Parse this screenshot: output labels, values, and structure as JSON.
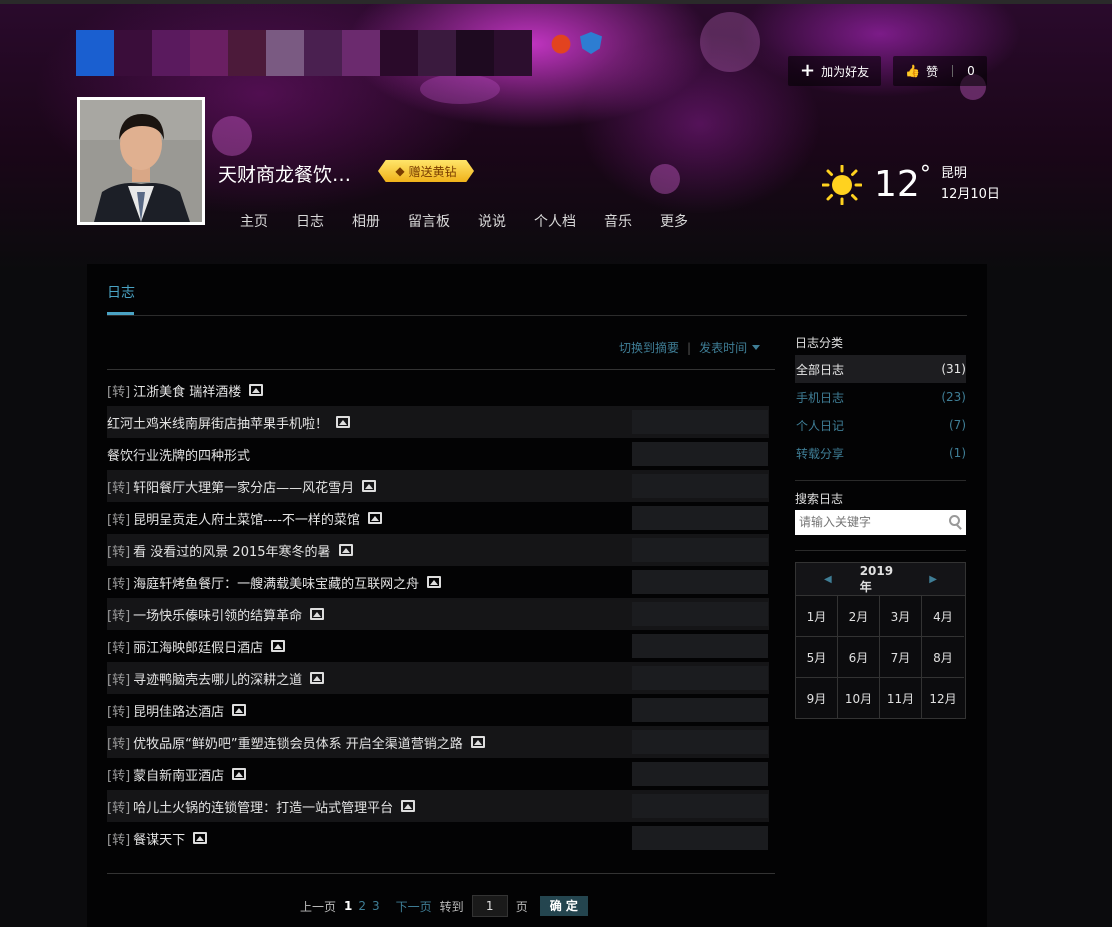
{
  "header": {
    "owner_name": "天财商龙餐饮…",
    "gift_label": "赠送黄钻",
    "add_friend_label": "加为好友",
    "like_label": "赞",
    "like_count": "0",
    "nav": [
      "主页",
      "日志",
      "相册",
      "留言板",
      "说说",
      "个人档",
      "音乐",
      "更多"
    ],
    "weather": {
      "temp": "12",
      "deg": "°",
      "city": "昆明",
      "date": "12月10日"
    }
  },
  "blog": {
    "tab_title": "日志",
    "switch_label": "切换到摘要",
    "sort_label": "发表时间",
    "posts": [
      {
        "tag": "[转]",
        "title": "江浙美食 瑞祥酒楼",
        "has_image": true
      },
      {
        "tag": "",
        "title": "红河土鸡米线南屏街店抽苹果手机啦！",
        "has_image": true
      },
      {
        "tag": "",
        "title": "餐饮行业洗牌的四种形式",
        "has_image": false
      },
      {
        "tag": "[转]",
        "title": "轩阳餐厅大理第一家分店——风花雪月",
        "has_image": true
      },
      {
        "tag": "[转]",
        "title": "昆明呈贡走人府土菜馆----不一样的菜馆",
        "has_image": true
      },
      {
        "tag": "[转]",
        "title": "看 没看过的风景 2015年寒冬的暑",
        "has_image": true
      },
      {
        "tag": "[转]",
        "title": "海庭轩烤鱼餐厅：一艘满载美味宝藏的互联网之舟",
        "has_image": true
      },
      {
        "tag": "[转]",
        "title": "一场快乐傣味引领的结算革命",
        "has_image": true
      },
      {
        "tag": "[转]",
        "title": "丽江海映郎廷假日酒店",
        "has_image": true
      },
      {
        "tag": "[转]",
        "title": "寻迹鸭脑壳去哪儿的深耕之道",
        "has_image": true
      },
      {
        "tag": "[转]",
        "title": "昆明佳路达酒店",
        "has_image": true
      },
      {
        "tag": "[转]",
        "title": "优牧品原“鲜奶吧”重塑连锁会员体系 开启全渠道营销之路",
        "has_image": true
      },
      {
        "tag": "[转]",
        "title": "蒙自新南亚酒店",
        "has_image": true
      },
      {
        "tag": "[转]",
        "title": "哈儿土火锅的连锁管理：打造一站式管理平台",
        "has_image": true
      },
      {
        "tag": "[转]",
        "title": "餐谋天下",
        "has_image": true
      }
    ]
  },
  "pager": {
    "prev": "上一页",
    "current": "1",
    "pages": [
      "2",
      "3"
    ],
    "next": "下一页",
    "goto_label": "转到",
    "goto_value": "1",
    "page_unit": "页",
    "ok": "确 定"
  },
  "sidebar": {
    "categories_title": "日志分类",
    "categories": [
      {
        "name": "全部日志",
        "count": "(31)"
      },
      {
        "name": "手机日志",
        "count": "(23)"
      },
      {
        "name": "个人日记",
        "count": "(7)"
      },
      {
        "name": "转载分享",
        "count": "(1)"
      }
    ],
    "search_title": "搜索日志",
    "search_placeholder": "请输入关键字",
    "calendar_year": "2019年",
    "months": [
      "1月",
      "2月",
      "3月",
      "4月",
      "5月",
      "6月",
      "7月",
      "8月",
      "9月",
      "10月",
      "11月",
      "12月"
    ]
  },
  "colors": {
    "accent": "#4aa3c4",
    "link": "#3f7e96",
    "gold": "#f0b21a"
  }
}
